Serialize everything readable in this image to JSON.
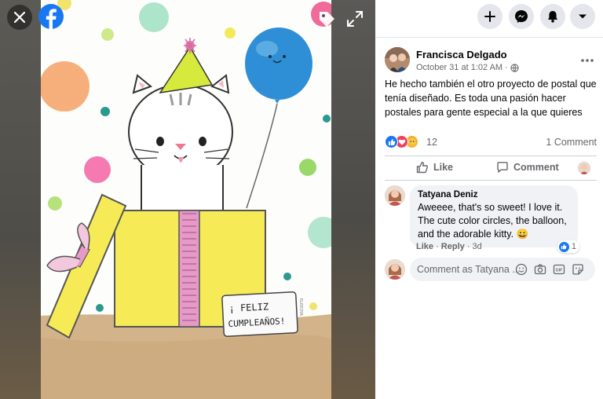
{
  "viewer": {
    "card_text_line1": "¡ FELIZ",
    "card_text_line2": "CUMPLEAÑOS!",
    "signature": "ELEEOYA"
  },
  "icons": {
    "close": "close-icon",
    "facebook": "facebook-logo-icon",
    "tag": "tag-icon",
    "expand": "expand-icon",
    "create": "plus-icon",
    "messenger": "messenger-icon",
    "notifications": "bell-icon",
    "account": "caret-down-icon"
  },
  "post": {
    "author": "Francisca Delgado",
    "timestamp": "October 31 at 1:02 AM",
    "audience_icon": "globe-icon",
    "text": "He hecho también el otro proyecto de postal que tenía diseñado. Es toda una pasión hacer postales para gente especial a la que quieres",
    "reaction_count": "12",
    "comment_count": "1 Comment",
    "like_label": "Like",
    "comment_label": "Comment"
  },
  "comment": {
    "author": "Tatyana Deniz",
    "text": "Aweeee, that's so sweet! I love it. The cute color circles, the balloon, and the adorable kitty. 😀",
    "like_count": "1",
    "like_action": "Like",
    "reply_action": "Reply",
    "age": "3d"
  },
  "composer": {
    "placeholder": "Comment as Tatyana ..."
  },
  "colors": {
    "facebook_blue": "#1877f2",
    "love_red": "#f33e58",
    "care_yellow": "#f7b125",
    "text_primary": "#050505",
    "text_secondary": "#65676b"
  }
}
